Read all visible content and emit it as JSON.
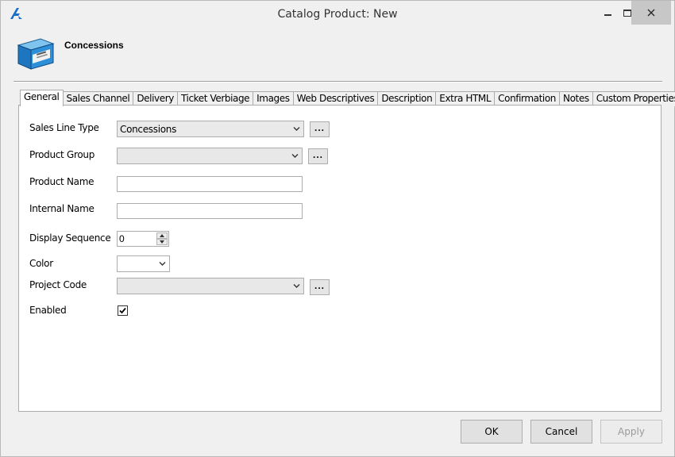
{
  "window": {
    "title": "Catalog Product: New",
    "app_icon": "app-logo-icon",
    "controls": [
      "minimize-icon",
      "maximize-icon",
      "close-icon"
    ]
  },
  "header": {
    "icon": "product-box-icon",
    "title": "Concessions"
  },
  "tabs": [
    {
      "label": "General",
      "active": true
    },
    {
      "label": "Sales Channel"
    },
    {
      "label": "Delivery"
    },
    {
      "label": "Ticket Verbiage"
    },
    {
      "label": "Images"
    },
    {
      "label": "Web Descriptives"
    },
    {
      "label": "Description"
    },
    {
      "label": "Extra HTML"
    },
    {
      "label": "Confirmation"
    },
    {
      "label": "Notes"
    },
    {
      "label": "Custom Properties"
    }
  ],
  "form": {
    "sales_line_type": {
      "label": "Sales Line Type",
      "value": "Concessions",
      "browse": "..."
    },
    "product_group": {
      "label": "Product Group",
      "value": "",
      "browse": "..."
    },
    "product_name": {
      "label": "Product Name",
      "value": ""
    },
    "internal_name": {
      "label": "Internal Name",
      "value": ""
    },
    "display_sequence": {
      "label": "Display Sequence",
      "value": "0"
    },
    "color": {
      "label": "Color",
      "value": ""
    },
    "project_code": {
      "label": "Project Code",
      "value": "",
      "browse": "..."
    },
    "enabled": {
      "label": "Enabled",
      "checked": true
    }
  },
  "buttons": {
    "ok": "OK",
    "cancel": "Cancel",
    "apply": "Apply"
  },
  "colors": {
    "accent_blue": "#1a6fc4",
    "window_bg": "#f0f0f0",
    "close_bg": "#c7c7c7"
  }
}
